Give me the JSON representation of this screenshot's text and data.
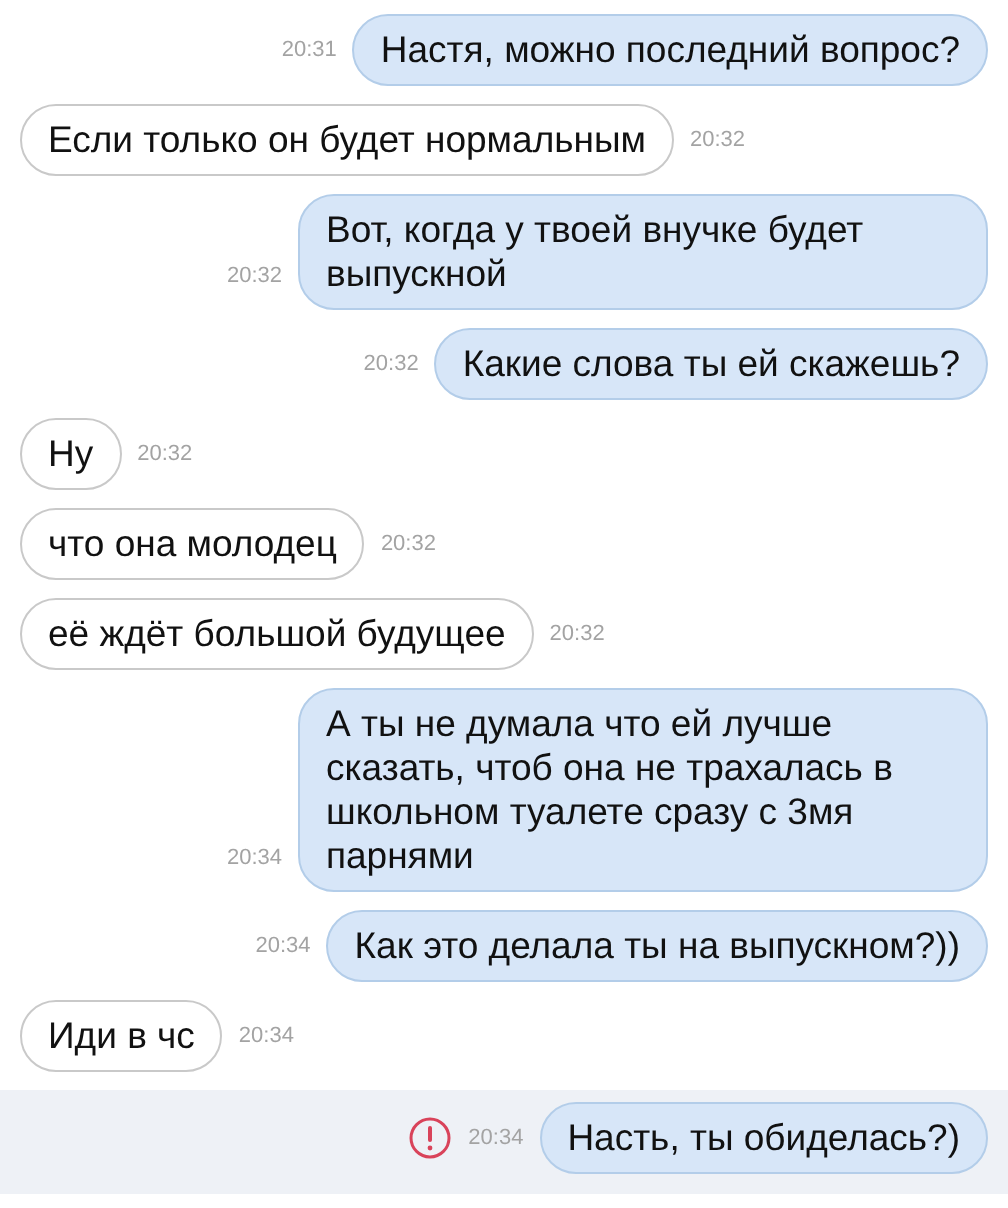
{
  "messages": [
    {
      "kind": "outgoing",
      "text": "Настя, можно последний вопрос?",
      "time": "20:31",
      "failed": false
    },
    {
      "kind": "incoming",
      "text": "Если только он будет нормальным",
      "time": "20:32",
      "failed": false
    },
    {
      "kind": "outgoing",
      "text": "Вот, когда у твоей внучке будет выпускной",
      "time": "20:32",
      "failed": false
    },
    {
      "kind": "outgoing",
      "text": "Какие слова ты ей скажешь?",
      "time": "20:32",
      "failed": false
    },
    {
      "kind": "incoming",
      "text": "Ну",
      "time": "20:32",
      "failed": false
    },
    {
      "kind": "incoming",
      "text": "что она молодец",
      "time": "20:32",
      "failed": false
    },
    {
      "kind": "incoming",
      "text": "её ждёт большой будущее",
      "time": "20:32",
      "failed": false
    },
    {
      "kind": "outgoing",
      "text": "А ты не думала что ей лучше сказать, чтоб она не трахалась в школьном туалете сразу с 3мя парнями",
      "time": "20:34",
      "failed": false
    },
    {
      "kind": "outgoing",
      "text": "Как это делала ты на выпускном?))",
      "time": "20:34",
      "failed": false
    },
    {
      "kind": "incoming",
      "text": "Иди в чс",
      "time": "20:34",
      "failed": false
    },
    {
      "kind": "outgoing",
      "text": "Насть, ты обиделась?)",
      "time": "20:34",
      "failed": true
    }
  ]
}
